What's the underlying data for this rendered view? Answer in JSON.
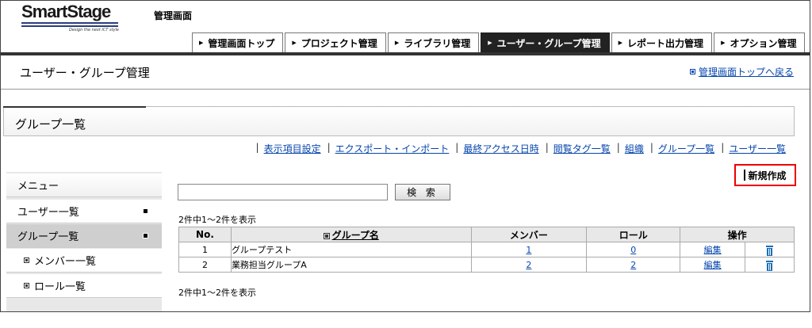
{
  "header": {
    "logo_text": "SmartStage",
    "logo_tagline": "Design the next ICT style",
    "admin_title": "管理画面"
  },
  "nav": {
    "tabs": [
      {
        "label": "管理画面トップ",
        "active": false
      },
      {
        "label": "プロジェクト管理",
        "active": false
      },
      {
        "label": "ライブラリ管理",
        "active": false
      },
      {
        "label": "ユーザー・グループ管理",
        "active": true
      },
      {
        "label": "レポート出力管理",
        "active": false
      },
      {
        "label": "オプション管理",
        "active": false
      }
    ]
  },
  "page": {
    "title": "ユーザー・グループ管理",
    "back_link": "管理画面トップへ戻る",
    "section_title": "グループ一覧"
  },
  "links": [
    "表示項目設定",
    "エクスポート・インポート",
    "最終アクセス日時",
    "閲覧タグ一覧",
    "組織",
    "グループ一覧",
    "ユーザー一覧"
  ],
  "sidebar": {
    "header": "メニュー",
    "items": [
      "ユーザー一覧",
      "グループ一覧",
      "メンバー一覧",
      "ロール一覧"
    ]
  },
  "search": {
    "value": "",
    "button": "検 索"
  },
  "new_button": "新規作成",
  "count_text": "2件中1～2件を表示",
  "table": {
    "headers": {
      "no": "No.",
      "name": "グループ名",
      "member": "メンバー",
      "role": "ロール",
      "ops": "操作"
    },
    "rows": [
      {
        "no": "1",
        "name": "グループテスト",
        "member": "1",
        "role": "0",
        "edit": "編集"
      },
      {
        "no": "2",
        "name": "業務担当グループA",
        "member": "2",
        "role": "2",
        "edit": "編集"
      }
    ]
  },
  "colors": {
    "accent": "#e00000",
    "link": "#0645ad",
    "active_tab": "#222222"
  }
}
